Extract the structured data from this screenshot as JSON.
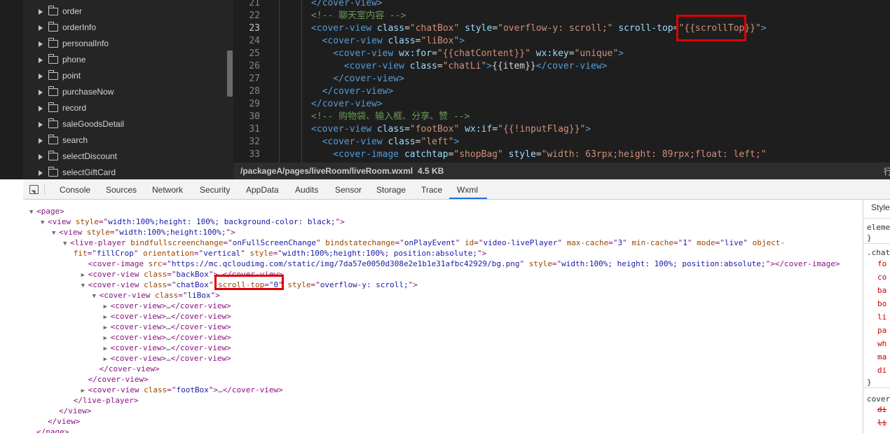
{
  "file_tree": {
    "items": [
      {
        "label": "order"
      },
      {
        "label": "orderInfo"
      },
      {
        "label": "personalInfo"
      },
      {
        "label": "phone"
      },
      {
        "label": "point"
      },
      {
        "label": "purchaseNow"
      },
      {
        "label": "record"
      },
      {
        "label": "saleGoodsDetail"
      },
      {
        "label": "search"
      },
      {
        "label": "selectDiscount"
      },
      {
        "label": "selectGiftCard"
      }
    ]
  },
  "editor": {
    "current_line": "23",
    "lines": [
      {
        "num": "21",
        "tokens": [
          {
            "t": "</cover-view>",
            "c": "tag"
          }
        ]
      },
      {
        "num": "22",
        "tokens": [
          {
            "t": "<!-- 聊天室内容 -->",
            "c": "com"
          }
        ]
      },
      {
        "num": "23",
        "tokens": [
          {
            "t": "<cover-view ",
            "c": "tag"
          },
          {
            "t": "class",
            "c": "attr"
          },
          {
            "t": "=",
            "c": "txt"
          },
          {
            "t": "\"chatBox\"",
            "c": "str"
          },
          {
            "t": " style",
            "c": "attr"
          },
          {
            "t": "=",
            "c": "txt"
          },
          {
            "t": "\"overflow-y: scroll;\"",
            "c": "str"
          },
          {
            "t": " scroll-top",
            "c": "attr"
          },
          {
            "t": "=",
            "c": "txt"
          },
          {
            "t": "\"{{scrollTop}}\"",
            "c": "str"
          },
          {
            "t": ">",
            "c": "tag"
          }
        ]
      },
      {
        "num": "24",
        "tokens": [
          {
            "t": "<cover-view ",
            "c": "tag"
          },
          {
            "t": "class",
            "c": "attr"
          },
          {
            "t": "=",
            "c": "txt"
          },
          {
            "t": "\"liBox\"",
            "c": "str"
          },
          {
            "t": ">",
            "c": "tag"
          }
        ]
      },
      {
        "num": "25",
        "tokens": [
          {
            "t": "<cover-view ",
            "c": "tag"
          },
          {
            "t": "wx:for",
            "c": "attr"
          },
          {
            "t": "=",
            "c": "txt"
          },
          {
            "t": "\"{{chatContent}}\"",
            "c": "str"
          },
          {
            "t": " wx:key",
            "c": "attr"
          },
          {
            "t": "=",
            "c": "txt"
          },
          {
            "t": "\"unique\"",
            "c": "str"
          },
          {
            "t": ">",
            "c": "tag"
          }
        ]
      },
      {
        "num": "26",
        "tokens": [
          {
            "t": "<cover-view ",
            "c": "tag"
          },
          {
            "t": "class",
            "c": "attr"
          },
          {
            "t": "=",
            "c": "txt"
          },
          {
            "t": "\"chatLi\"",
            "c": "str"
          },
          {
            "t": ">",
            "c": "tag"
          },
          {
            "t": "{{item}}",
            "c": "txt"
          },
          {
            "t": "</cover-view>",
            "c": "tag"
          }
        ]
      },
      {
        "num": "27",
        "tokens": [
          {
            "t": "</cover-view>",
            "c": "tag"
          }
        ]
      },
      {
        "num": "28",
        "tokens": [
          {
            "t": "</cover-view>",
            "c": "tag"
          }
        ]
      },
      {
        "num": "29",
        "tokens": [
          {
            "t": "</cover-view>",
            "c": "tag"
          }
        ]
      },
      {
        "num": "30",
        "tokens": [
          {
            "t": "<!-- 购物袋、输入框、分享、赞 -->",
            "c": "com"
          }
        ]
      },
      {
        "num": "31",
        "tokens": [
          {
            "t": "<cover-view ",
            "c": "tag"
          },
          {
            "t": "class",
            "c": "attr"
          },
          {
            "t": "=",
            "c": "txt"
          },
          {
            "t": "\"footBox\"",
            "c": "str"
          },
          {
            "t": " wx:if",
            "c": "attr"
          },
          {
            "t": "=",
            "c": "txt"
          },
          {
            "t": "\"{{!inputFlag}}\"",
            "c": "str"
          },
          {
            "t": ">",
            "c": "tag"
          }
        ]
      },
      {
        "num": "32",
        "tokens": [
          {
            "t": "<cover-view ",
            "c": "tag"
          },
          {
            "t": "class",
            "c": "attr"
          },
          {
            "t": "=",
            "c": "txt"
          },
          {
            "t": "\"left\"",
            "c": "str"
          },
          {
            "t": ">",
            "c": "tag"
          }
        ]
      },
      {
        "num": "33",
        "tokens": [
          {
            "t": "<cover-image ",
            "c": "tag"
          },
          {
            "t": "catchtap",
            "c": "attr"
          },
          {
            "t": "=",
            "c": "txt"
          },
          {
            "t": "\"shopBag\"",
            "c": "str"
          },
          {
            "t": " style",
            "c": "attr"
          },
          {
            "t": "=",
            "c": "txt"
          },
          {
            "t": "\"width: 63rpx;height: 89rpx;float: left;\"",
            "c": "str"
          }
        ]
      }
    ]
  },
  "statusbar": {
    "path": "/packageA/pages/liveRoom/liveRoom.wxml",
    "size": "4.5 KB",
    "edge_char": "行"
  },
  "devtools": {
    "tabs": [
      {
        "label": "Console"
      },
      {
        "label": "Sources"
      },
      {
        "label": "Network"
      },
      {
        "label": "Security"
      },
      {
        "label": "AppData"
      },
      {
        "label": "Audits"
      },
      {
        "label": "Sensor"
      },
      {
        "label": "Storage"
      },
      {
        "label": "Trace"
      },
      {
        "label": "Wxml"
      }
    ],
    "active_tab": "Wxml",
    "dom_lines": [
      {
        "tri": "▼",
        "tokens": [
          {
            "t": "<page>",
            "c": "tag"
          }
        ]
      },
      {
        "tri": "▼",
        "tokens": [
          {
            "t": "<view ",
            "c": "tag"
          },
          {
            "t": "style",
            "c": "attr"
          },
          {
            "t": "=\"",
            "c": "tag"
          },
          {
            "t": "width:100%;height: 100%; background-color: black;",
            "c": "val"
          },
          {
            "t": "\">",
            "c": "tag"
          }
        ]
      },
      {
        "tri": "▼",
        "tokens": [
          {
            "t": "<view ",
            "c": "tag"
          },
          {
            "t": "style",
            "c": "attr"
          },
          {
            "t": "=\"",
            "c": "tag"
          },
          {
            "t": "width:100%;height:100%;",
            "c": "val"
          },
          {
            "t": "\">",
            "c": "tag"
          }
        ]
      },
      {
        "tri": "▼",
        "tokens": [
          {
            "t": "<live-player ",
            "c": "tag"
          },
          {
            "t": "bindfullscreenchange",
            "c": "attr"
          },
          {
            "t": "=\"",
            "c": "tag"
          },
          {
            "t": "onFullScreenChange",
            "c": "val"
          },
          {
            "t": "\" ",
            "c": "tag"
          },
          {
            "t": "bindstatechange",
            "c": "attr"
          },
          {
            "t": "=\"",
            "c": "tag"
          },
          {
            "t": "onPlayEvent",
            "c": "val"
          },
          {
            "t": "\" ",
            "c": "tag"
          },
          {
            "t": "id",
            "c": "attr"
          },
          {
            "t": "=\"",
            "c": "tag"
          },
          {
            "t": "video-livePlayer",
            "c": "val"
          },
          {
            "t": "\" ",
            "c": "tag"
          },
          {
            "t": "max-cache",
            "c": "attr"
          },
          {
            "t": "=\"",
            "c": "tag"
          },
          {
            "t": "3",
            "c": "val"
          },
          {
            "t": "\" ",
            "c": "tag"
          },
          {
            "t": "min-cache",
            "c": "attr"
          },
          {
            "t": "=\"",
            "c": "tag"
          },
          {
            "t": "1",
            "c": "val"
          },
          {
            "t": "\" ",
            "c": "tag"
          },
          {
            "t": "mode",
            "c": "attr"
          },
          {
            "t": "=\"",
            "c": "tag"
          },
          {
            "t": "live",
            "c": "val"
          },
          {
            "t": "\" ",
            "c": "tag"
          },
          {
            "t": "object-",
            "c": "attr"
          }
        ]
      },
      {
        "tri": "",
        "tokens": [
          {
            "t": "fit",
            "c": "attr"
          },
          {
            "t": "=\"",
            "c": "tag"
          },
          {
            "t": "fillCrop",
            "c": "val"
          },
          {
            "t": "\" ",
            "c": "tag"
          },
          {
            "t": "orientation",
            "c": "attr"
          },
          {
            "t": "=\"",
            "c": "tag"
          },
          {
            "t": "vertical",
            "c": "val"
          },
          {
            "t": "\" ",
            "c": "tag"
          },
          {
            "t": "style",
            "c": "attr"
          },
          {
            "t": "=\"",
            "c": "tag"
          },
          {
            "t": "width:100%;height:100%; position:absolute;",
            "c": "val"
          },
          {
            "t": "\">",
            "c": "tag"
          }
        ]
      },
      {
        "tri": "",
        "tokens": [
          {
            "t": "<cover-image ",
            "c": "tag"
          },
          {
            "t": "src",
            "c": "attr"
          },
          {
            "t": "=\"",
            "c": "tag"
          },
          {
            "t": "https://mc.qcloudimg.com/static/img/7da57e0050d308e2e1b1e31afbc42929/bg.png",
            "c": "val"
          },
          {
            "t": "\" ",
            "c": "tag"
          },
          {
            "t": "style",
            "c": "attr"
          },
          {
            "t": "=\"",
            "c": "tag"
          },
          {
            "t": "width:100%; height: 100%; position:absolute;",
            "c": "val"
          },
          {
            "t": "\"></cover-image>",
            "c": "tag"
          }
        ]
      },
      {
        "tri": "▶",
        "tokens": [
          {
            "t": "<cover-view ",
            "c": "tag"
          },
          {
            "t": "class",
            "c": "attr"
          },
          {
            "t": "=\"",
            "c": "tag"
          },
          {
            "t": "backBox",
            "c": "val"
          },
          {
            "t": "\">",
            "c": "tag"
          },
          {
            "t": "…",
            "c": "ell"
          },
          {
            "t": "</cover-view>",
            "c": "tag"
          }
        ]
      },
      {
        "tri": "▼",
        "tokens": [
          {
            "t": "<cover-view ",
            "c": "tag"
          },
          {
            "t": "class",
            "c": "attr"
          },
          {
            "t": "=\"",
            "c": "tag"
          },
          {
            "t": "chatBox",
            "c": "val"
          },
          {
            "t": "\" ",
            "c": "tag"
          },
          {
            "t": "scroll-top",
            "c": "attr"
          },
          {
            "t": "=\"",
            "c": "tag"
          },
          {
            "t": "0",
            "c": "val"
          },
          {
            "t": "\" ",
            "c": "tag"
          },
          {
            "t": "style",
            "c": "attr"
          },
          {
            "t": "=\"",
            "c": "tag"
          },
          {
            "t": "overflow-y: scroll;",
            "c": "val"
          },
          {
            "t": "\">",
            "c": "tag"
          }
        ]
      },
      {
        "tri": "▼",
        "tokens": [
          {
            "t": "<cover-view ",
            "c": "tag"
          },
          {
            "t": "class",
            "c": "attr"
          },
          {
            "t": "=\"",
            "c": "tag"
          },
          {
            "t": "liBox",
            "c": "val"
          },
          {
            "t": "\">",
            "c": "tag"
          }
        ]
      },
      {
        "tri": "▶",
        "tokens": [
          {
            "t": "<cover-view>",
            "c": "tag"
          },
          {
            "t": "…",
            "c": "ell"
          },
          {
            "t": "</cover-view>",
            "c": "tag"
          }
        ]
      },
      {
        "tri": "▶",
        "tokens": [
          {
            "t": "<cover-view>",
            "c": "tag"
          },
          {
            "t": "…",
            "c": "ell"
          },
          {
            "t": "</cover-view>",
            "c": "tag"
          }
        ]
      },
      {
        "tri": "▶",
        "tokens": [
          {
            "t": "<cover-view>",
            "c": "tag"
          },
          {
            "t": "…",
            "c": "ell"
          },
          {
            "t": "</cover-view>",
            "c": "tag"
          }
        ]
      },
      {
        "tri": "▶",
        "tokens": [
          {
            "t": "<cover-view>",
            "c": "tag"
          },
          {
            "t": "…",
            "c": "ell"
          },
          {
            "t": "</cover-view>",
            "c": "tag"
          }
        ]
      },
      {
        "tri": "▶",
        "tokens": [
          {
            "t": "<cover-view>",
            "c": "tag"
          },
          {
            "t": "…",
            "c": "ell"
          },
          {
            "t": "</cover-view>",
            "c": "tag"
          }
        ]
      },
      {
        "tri": "▶",
        "tokens": [
          {
            "t": "<cover-view>",
            "c": "tag"
          },
          {
            "t": "…",
            "c": "ell"
          },
          {
            "t": "</cover-view>",
            "c": "tag"
          }
        ]
      },
      {
        "tri": "",
        "tokens": [
          {
            "t": "</cover-view>",
            "c": "tag"
          }
        ]
      },
      {
        "tri": "",
        "tokens": [
          {
            "t": "</cover-view>",
            "c": "tag"
          }
        ]
      },
      {
        "tri": "▶",
        "tokens": [
          {
            "t": "<cover-view ",
            "c": "tag"
          },
          {
            "t": "class",
            "c": "attr"
          },
          {
            "t": "=\"",
            "c": "tag"
          },
          {
            "t": "footBox",
            "c": "val"
          },
          {
            "t": "\">",
            "c": "tag"
          },
          {
            "t": "…",
            "c": "ell"
          },
          {
            "t": "</cover-view>",
            "c": "tag"
          }
        ]
      },
      {
        "tri": "",
        "tokens": [
          {
            "t": "</live-player>",
            "c": "tag"
          }
        ]
      },
      {
        "tri": "",
        "tokens": [
          {
            "t": "</view>",
            "c": "tag"
          }
        ]
      },
      {
        "tri": "",
        "tokens": [
          {
            "t": "</view>",
            "c": "tag"
          }
        ]
      },
      {
        "tri": "",
        "tokens": [
          {
            "t": "</page>",
            "c": "tag"
          }
        ]
      }
    ]
  },
  "styles_pane": {
    "lines": [
      {
        "text": "Styles",
        "kind": "head"
      },
      {
        "text": "element",
        "kind": "sel"
      },
      {
        "text": "}",
        "kind": "sel"
      },
      {
        "text": ".chat",
        "kind": "sel"
      },
      {
        "text": "fo",
        "kind": "prop"
      },
      {
        "text": "co",
        "kind": "prop"
      },
      {
        "text": "ba",
        "kind": "prop"
      },
      {
        "text": "bo",
        "kind": "prop"
      },
      {
        "text": "li",
        "kind": "prop"
      },
      {
        "text": "pa",
        "kind": "prop"
      },
      {
        "text": "wh",
        "kind": "prop"
      },
      {
        "text": "ma",
        "kind": "prop"
      },
      {
        "text": "di",
        "kind": "prop"
      },
      {
        "text": "}",
        "kind": "sel"
      },
      {
        "text": "cover",
        "kind": "sel"
      },
      {
        "text": "di",
        "kind": "strike"
      },
      {
        "text": "li",
        "kind": "strike"
      }
    ]
  },
  "colors": {
    "highlight_box": "#e00000",
    "active_tab_underline": "#1a73e8"
  }
}
